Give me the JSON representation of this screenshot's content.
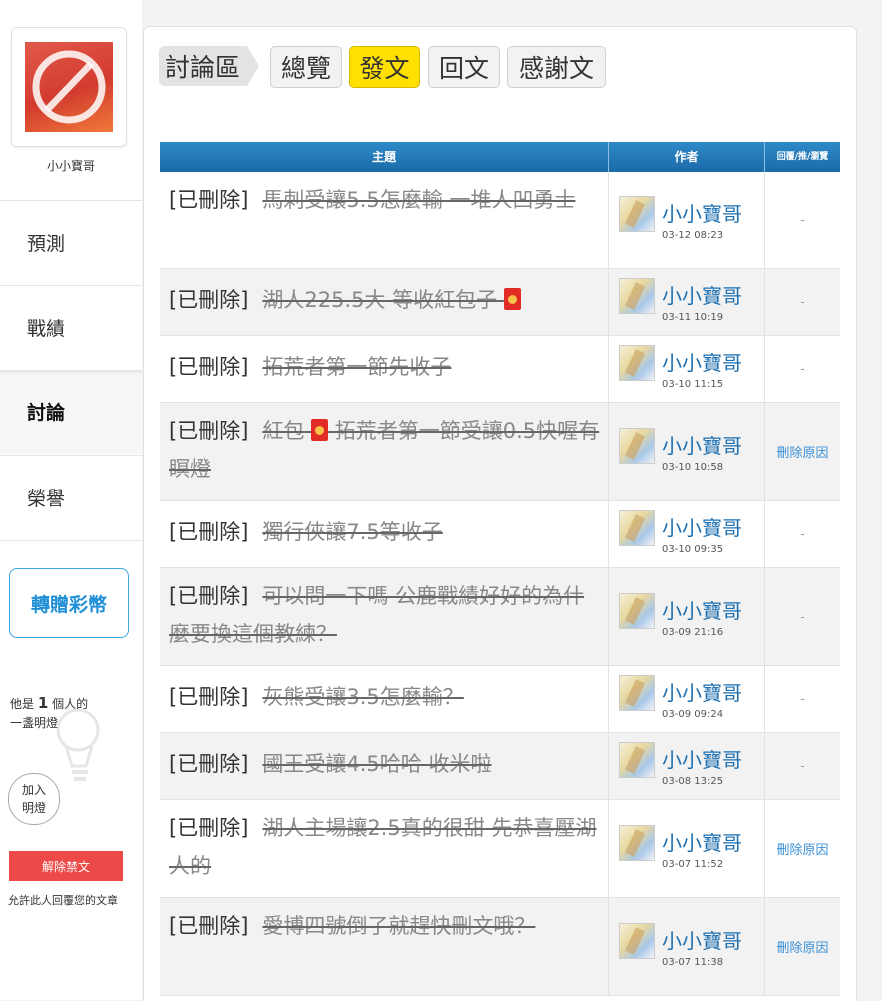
{
  "sidebar": {
    "username": "小小寶哥",
    "nav": [
      "預測",
      "戰績",
      "討論",
      "榮譽"
    ],
    "gift_button": "轉贈彩幣",
    "lamp_prefix": "他是",
    "lamp_count": "1",
    "lamp_suffix": "個人的",
    "lamp_line2": "一盞明燈",
    "join_line1": "加入",
    "join_line2": "明燈",
    "unban_button": "解除禁文",
    "allow_text": "允許此人回覆您的文章"
  },
  "tabs": [
    "討論區",
    "總覽",
    "發文",
    "回文",
    "感謝文"
  ],
  "table": {
    "headers": [
      "主題",
      "作者",
      "回覆/推/瀏覽"
    ],
    "rows": [
      {
        "tag": "[已刪除]",
        "title": "馬刺受讓5.5怎麼輸 一堆人凹勇士",
        "title2": "",
        "author": "小小寶哥",
        "date": "03-12 08:23",
        "stat": "-"
      },
      {
        "tag": "[已刪除]",
        "title": "湖人225.5大 等收紅包子",
        "title2": "",
        "author": "小小寶哥",
        "date": "03-11 10:19",
        "stat": "-"
      },
      {
        "tag": "[已刪除]",
        "title": "拓荒者第一節先收子",
        "title2": "",
        "author": "小小寶哥",
        "date": "03-10 11:15",
        "stat": "-"
      },
      {
        "tag": "[已刪除]",
        "title": "紅包",
        "title2": " 拓荒者第一節受讓0.5快喔有瞑燈",
        "author": "小小寶哥",
        "date": "03-10 10:58",
        "stat": "刪除原因"
      },
      {
        "tag": "[已刪除]",
        "title": "獨行俠讓7.5等收子",
        "title2": "",
        "author": "小小寶哥",
        "date": "03-10 09:35",
        "stat": "-"
      },
      {
        "tag": "[已刪除]",
        "title": "可以問一下嗎 公鹿戰績好好的為什麼要換這個教練？",
        "title2": "",
        "author": "小小寶哥",
        "date": "03-09 21:16",
        "stat": "-"
      },
      {
        "tag": "[已刪除]",
        "title": "灰熊受讓3.5怎麼輸？",
        "title2": "",
        "author": "小小寶哥",
        "date": "03-09 09:24",
        "stat": "-"
      },
      {
        "tag": "[已刪除]",
        "title": "國王受讓4.5哈哈 收米啦",
        "title2": "",
        "author": "小小寶哥",
        "date": "03-08 13:25",
        "stat": "-"
      },
      {
        "tag": "[已刪除]",
        "title": "湖人主場讓2.5真的很甜 先恭喜壓湖人的",
        "title2": "",
        "author": "小小寶哥",
        "date": "03-07 11:52",
        "stat": "刪除原因"
      },
      {
        "tag": "[已刪除]",
        "title": "愛博四號倒了就趕快刪文哦？",
        "title2": "",
        "author": "小小寶哥",
        "date": "03-07 11:38",
        "stat": "刪除原因"
      }
    ]
  },
  "icons": {
    "avatar": "no-entry-icon",
    "bulb": "lightbulb-icon",
    "envelope": "red-envelope-icon"
  },
  "colors": {
    "accent": "#1e8fd6",
    "active_tab": "#ffe000",
    "header": "#1b6aa8",
    "danger": "#ec4a48"
  }
}
